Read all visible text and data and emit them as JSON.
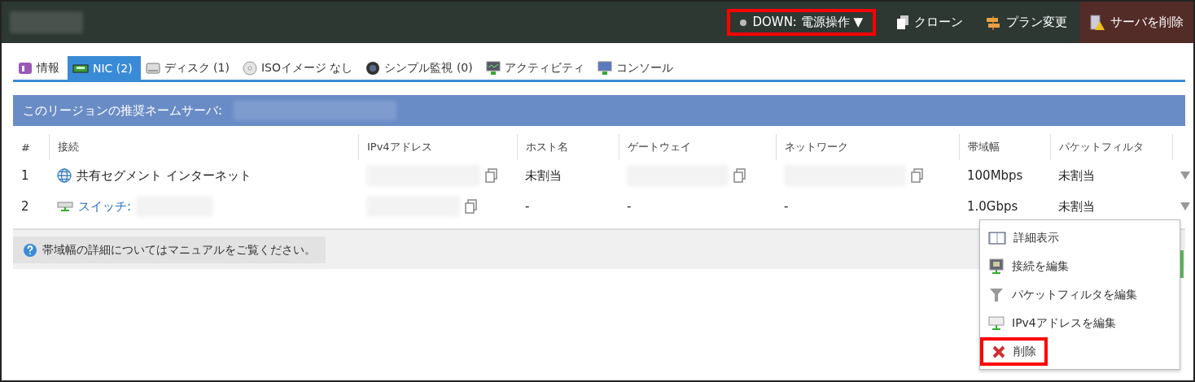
{
  "header": {
    "actions": [
      {
        "kind": "power",
        "label": "DOWN: 電源操作 ▼",
        "highlighted": true
      },
      {
        "kind": "clone",
        "label": "クローン",
        "highlighted": false
      },
      {
        "kind": "plan",
        "label": "プラン変更",
        "highlighted": false
      },
      {
        "kind": "delete",
        "label": "サーバを削除",
        "highlighted": false
      }
    ]
  },
  "tabs": [
    {
      "kind": "info",
      "label": "情報",
      "selected": false
    },
    {
      "kind": "nic",
      "label": "NIC (2)",
      "selected": true
    },
    {
      "kind": "disk",
      "label": "ディスク (1)",
      "selected": false
    },
    {
      "kind": "iso",
      "label": "ISOイメージ なし",
      "selected": false
    },
    {
      "kind": "monitor",
      "label": "シンプル監視 (0)",
      "selected": false
    },
    {
      "kind": "activity",
      "label": "アクティビティ",
      "selected": false
    },
    {
      "kind": "console",
      "label": "コンソール",
      "selected": false
    }
  ],
  "banner": {
    "text": "このリージョンの推奨ネームサーバ:"
  },
  "table": {
    "columns": [
      "#",
      "接続",
      "IPv4アドレス",
      "ホスト名",
      "ゲートウェイ",
      "ネットワーク",
      "帯域幅",
      "パケットフィルタ"
    ],
    "rows": [
      {
        "index": "1",
        "kind": "internet",
        "connection": "共有セグメント インターネット",
        "hostname": "未割当",
        "bandwidth": "100Mbps",
        "packet_filter": "未割当"
      },
      {
        "index": "2",
        "kind": "switch",
        "connection": "スイッチ:",
        "hostname": "-",
        "gateway": "-",
        "network": "-",
        "bandwidth": "1.0Gbps",
        "packet_filter": "未割当"
      }
    ]
  },
  "footer": {
    "note": "帯域幅の詳細についてはマニュアルをご覧ください。"
  },
  "context_menu": {
    "items": [
      {
        "kind": "details",
        "label": "詳細表示",
        "highlighted": false
      },
      {
        "kind": "edit_connection",
        "label": "接続を編集",
        "highlighted": false
      },
      {
        "kind": "edit_filter",
        "label": "パケットフィルタを編集",
        "highlighted": false
      },
      {
        "kind": "edit_ipv4",
        "label": "IPv4アドレスを編集",
        "highlighted": false
      },
      {
        "kind": "delete",
        "label": "削除",
        "highlighted": true
      }
    ]
  }
}
